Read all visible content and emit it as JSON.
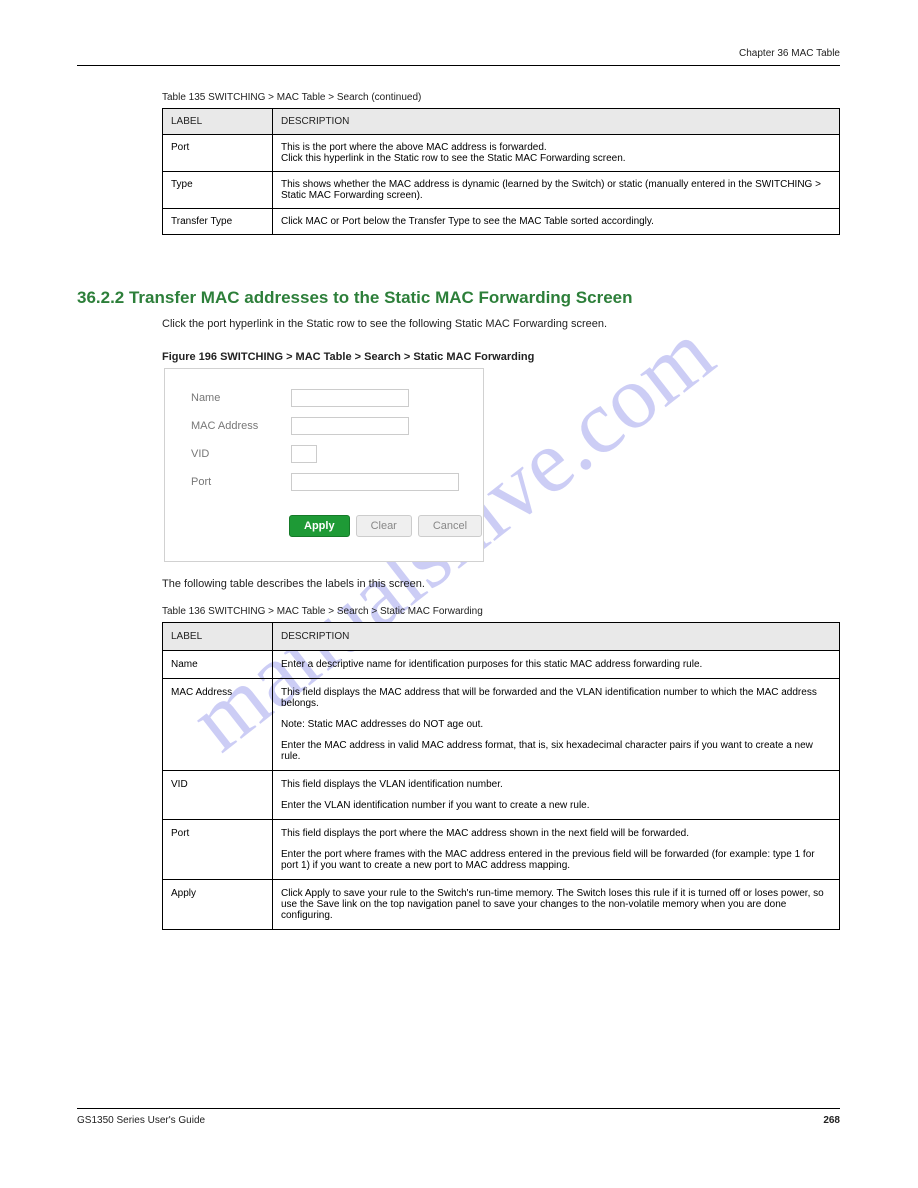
{
  "header": {
    "left": "",
    "right": "Chapter 36 MAC Table"
  },
  "footer": {
    "left": "GS1350 Series User's Guide",
    "right": "268"
  },
  "watermark": "manualshive.com",
  "table1": {
    "caption": "Table 135   SWITCHING > MAC Table > Search (continued)",
    "header": {
      "c1": "LABEL",
      "c2": "DESCRIPTION"
    },
    "rows": [
      {
        "c1": "Port",
        "c2_lines": [
          "This is the port where the above MAC address is forwarded.",
          "Click this hyperlink in the Static row to see the Static MAC Forwarding screen."
        ]
      },
      {
        "c1": "Type",
        "c2_lines": [
          "This shows whether the MAC address is dynamic (learned by the Switch) or static (manually entered in the SWITCHING > Static MAC Forwarding screen)."
        ]
      },
      {
        "c1": "Transfer Type",
        "c2_lines": [
          "Click MAC or Port below the Transfer Type to see the MAC Table sorted accordingly."
        ]
      }
    ]
  },
  "section": {
    "heading": "36.2.2  Transfer MAC addresses to the Static MAC Forwarding Screen",
    "body": "Click the port hyperlink in the Static row to see the following Static MAC Forwarding screen."
  },
  "figure_caption": "Figure 196   SWITCHING > MAC Table > Search > Static MAC Forwarding",
  "dialog": {
    "labels": {
      "name": "Name",
      "mac": "MAC Address",
      "vid": "VID",
      "port": "Port"
    },
    "buttons": {
      "apply": "Apply",
      "clear": "Clear",
      "cancel": "Cancel"
    }
  },
  "table2": {
    "intro": "The following table describes the labels in this screen.",
    "caption": "Table 136   SWITCHING > MAC Table > Search > Static MAC Forwarding",
    "header": {
      "c1": "LABEL",
      "c2": "DESCRIPTION"
    },
    "rows": [
      {
        "c1": "Name",
        "c2_paras": [
          "Enter a descriptive name for identification purposes for this static MAC address forwarding rule."
        ]
      },
      {
        "c1": "MAC Address",
        "c2_paras": [
          "This field displays the MAC address that will be forwarded and the VLAN identification number to which the MAC address belongs.",
          "Note: Static MAC addresses do NOT age out.",
          "Enter the MAC address in valid MAC address format, that is, six hexadecimal character pairs if you want to create a new rule."
        ]
      },
      {
        "c1": "VID",
        "c2_paras": [
          "This field displays the VLAN identification number.",
          "Enter the VLAN identification number if you want to create a new rule."
        ]
      },
      {
        "c1": "Port",
        "c2_paras": [
          "This field displays the port where the MAC address shown in the next field will be forwarded.",
          "Enter the port where frames with the MAC address entered in the previous field will be forwarded (for example: type 1 for port 1) if you want to create a new port to MAC address mapping."
        ]
      },
      {
        "c1": "Apply",
        "c2_paras": [
          "Click Apply to save your rule to the Switch's run-time memory. The Switch loses this rule if it is turned off or loses power, so use the Save link on the top navigation panel to save your changes to the non-volatile memory when you are done configuring."
        ]
      }
    ]
  }
}
